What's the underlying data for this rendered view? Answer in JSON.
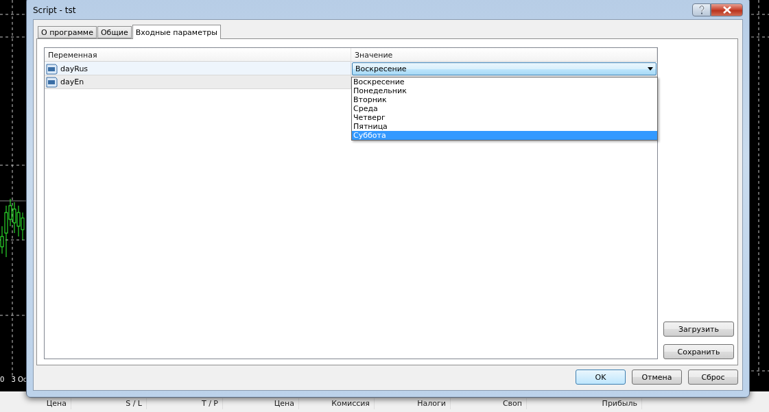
{
  "window": {
    "title": "Script - tst"
  },
  "tabs": [
    {
      "label": "О программе",
      "selected": false
    },
    {
      "label": "Общие",
      "selected": false
    },
    {
      "label": "Входные параметры",
      "selected": true
    }
  ],
  "table": {
    "columns": [
      "Переменная",
      "Значение"
    ],
    "rows": [
      {
        "name": "dayRus",
        "value": "Воскресение",
        "selected": true
      },
      {
        "name": "dayEn",
        "selected": false
      }
    ]
  },
  "dropdown": {
    "options": [
      {
        "label": "Воскресение",
        "selected": false
      },
      {
        "label": "Понедельник",
        "selected": false
      },
      {
        "label": "Вторник",
        "selected": false
      },
      {
        "label": "Среда",
        "selected": false
      },
      {
        "label": "Четверг",
        "selected": false
      },
      {
        "label": "Пятница",
        "selected": false
      },
      {
        "label": "Суббота",
        "selected": true
      }
    ]
  },
  "side_buttons": [
    "Загрузить",
    "Сохранить"
  ],
  "dialog_buttons": [
    {
      "label": "OK",
      "default": true
    },
    {
      "label": "Отмена",
      "default": false
    },
    {
      "label": "Сброс",
      "default": false
    }
  ],
  "chart": {
    "axis_labels": [
      "0",
      "3 Oc"
    ]
  },
  "terminal": {
    "columns": [
      "Цена",
      "S / L",
      "T / P",
      "Цена",
      "Комиссия",
      "Налоги",
      "Своп",
      "Прибыль"
    ]
  }
}
